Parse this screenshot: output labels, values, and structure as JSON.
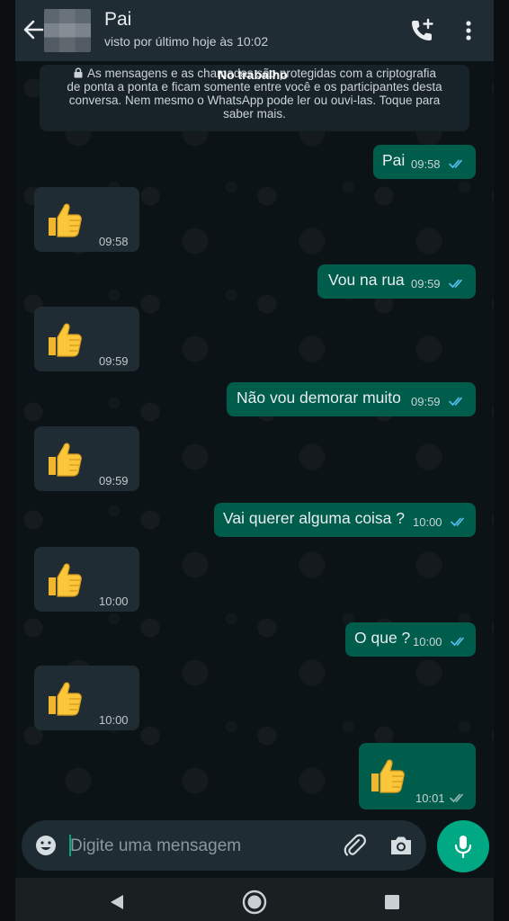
{
  "header": {
    "contact_name": "Pai",
    "status": "visto por último hoje às 10:02"
  },
  "notice": {
    "line1": "As mensagens e as chamadas são protegidas com a criptografia",
    "line2": "de ponta a ponta e ficam somente entre você e os participantes desta",
    "line3": "conversa. Nem mesmo o WhatsApp pode ler ou ouvi-las. Toque para",
    "line4": "saber mais.",
    "overlay_text": "No trabalho"
  },
  "messages": [
    {
      "direction": "out",
      "text": "Pai",
      "time": "09:58",
      "read": true
    },
    {
      "direction": "in",
      "emoji": "thumbs-up",
      "time": "09:58"
    },
    {
      "direction": "out",
      "text": "Vou na rua",
      "time": "09:59",
      "read": true
    },
    {
      "direction": "in",
      "emoji": "thumbs-up",
      "time": "09:59"
    },
    {
      "direction": "out",
      "text": "Não vou demorar muito",
      "time": "09:59",
      "read": true
    },
    {
      "direction": "in",
      "emoji": "thumbs-up",
      "time": "09:59"
    },
    {
      "direction": "out",
      "text": "Vai querer alguma coisa ?",
      "time": "10:00",
      "read": true
    },
    {
      "direction": "in",
      "emoji": "thumbs-up",
      "time": "10:00"
    },
    {
      "direction": "out",
      "text": "O que ?",
      "time": "10:00",
      "read": true
    },
    {
      "direction": "in",
      "emoji": "thumbs-up",
      "time": "10:00"
    },
    {
      "direction": "out",
      "emoji": "thumbs-up",
      "time": "10:01",
      "read": true
    }
  ],
  "composer": {
    "placeholder": "Digite uma mensagem"
  },
  "colors": {
    "header": "#1f2c34",
    "background": "#0c1317",
    "outgoing_bubble": "#005c4b",
    "incoming_bubble": "#202c33",
    "accent": "#00a884",
    "read_ticks": "#53bdeb"
  },
  "icons": [
    "back-arrow-icon",
    "add-call-icon",
    "menu-dots-icon",
    "lock-icon",
    "thumbs-up-icon",
    "double-check-icon",
    "emoji-icon",
    "attach-icon",
    "camera-icon",
    "mic-icon",
    "nav-back-icon",
    "nav-home-icon",
    "nav-recent-icon"
  ]
}
